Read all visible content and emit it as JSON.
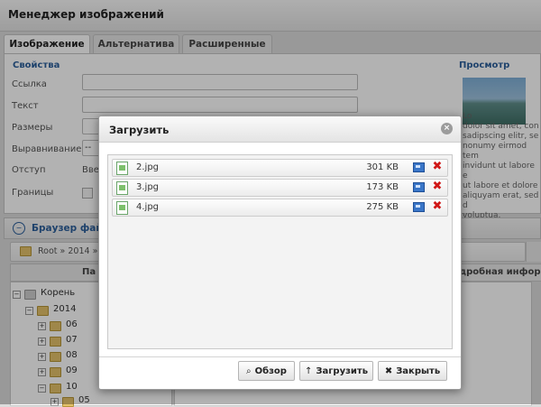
{
  "window": {
    "title": "Менеджер изображений"
  },
  "tabs": [
    {
      "label": "Изображение",
      "active": true
    },
    {
      "label": "Альтернатива",
      "active": false
    },
    {
      "label": "Расширенные",
      "active": false
    }
  ],
  "properties": {
    "title": "Свойства",
    "fields": [
      {
        "label": "Ссылка"
      },
      {
        "label": "Текст"
      },
      {
        "label": "Размеры"
      },
      {
        "label": "Выравнивание",
        "value_visible": "--"
      },
      {
        "label": "Отступ",
        "value_visible": "Вве"
      },
      {
        "label": "Границы"
      }
    ]
  },
  "preview": {
    "title": "Просмотр",
    "text": "Lo\ndolor sit amet, con\nsadipscing elitr, se\nnonumy eirmod tem\ninvidunt ut labore e\nut labore et dolore\naliquyam erat, sed d\nvoluptua."
  },
  "file_browser": {
    "title": "Браузер файлов",
    "breadcrumb": "Root » 2014 » 1",
    "folders_header": "Па",
    "details_header": "дробная инфор",
    "tree": [
      {
        "label": "Корень",
        "level": 0,
        "expanded": true
      },
      {
        "label": "2014",
        "level": 1,
        "expanded": true
      },
      {
        "label": "06",
        "level": 2
      },
      {
        "label": "07",
        "level": 2
      },
      {
        "label": "08",
        "level": 2
      },
      {
        "label": "09",
        "level": 2
      },
      {
        "label": "10",
        "level": 2,
        "expanded": true
      },
      {
        "label": "05",
        "level": 3
      }
    ]
  },
  "dialog": {
    "title": "Загрузить",
    "files": [
      {
        "name": "2.jpg",
        "size": "301 KB"
      },
      {
        "name": "3.jpg",
        "size": "173 KB"
      },
      {
        "name": "4.jpg",
        "size": "275 KB"
      }
    ],
    "buttons": {
      "browse": "Обзор",
      "upload": "Загрузить",
      "close": "Закрыть"
    }
  }
}
